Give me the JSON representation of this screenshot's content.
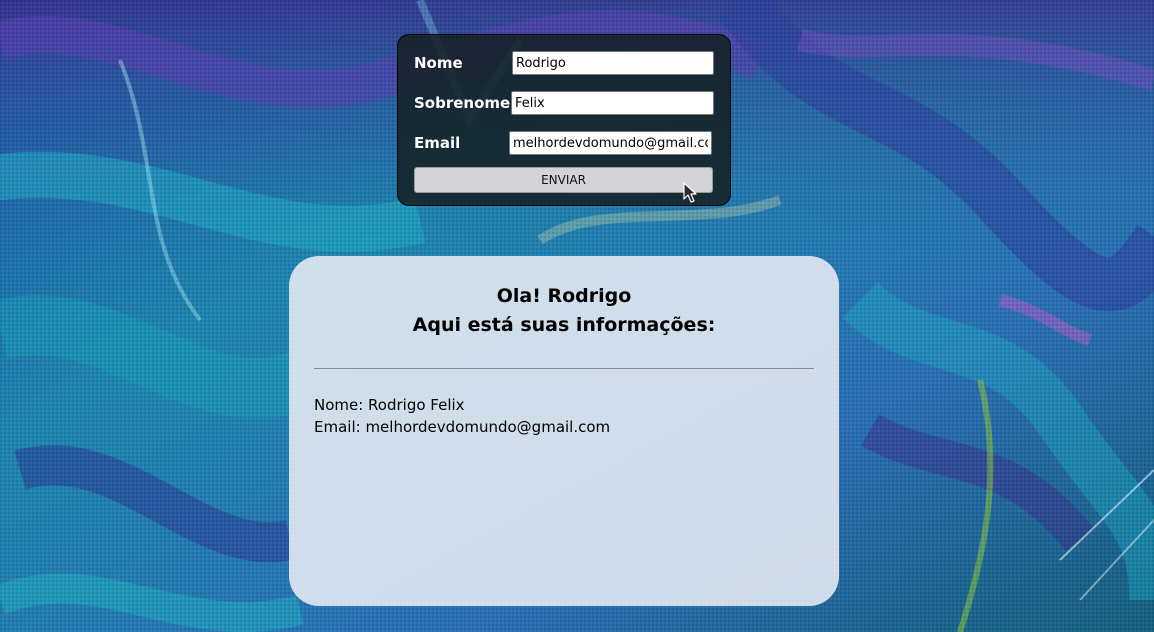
{
  "form": {
    "fields": [
      {
        "label": "Nome",
        "value": "Rodrigo",
        "placeholder": ""
      },
      {
        "label": "Sobrenome",
        "value": "Felix",
        "placeholder": ""
      },
      {
        "label": "Email",
        "value": "melhordevdomundo@gmail.com",
        "placeholder": ""
      }
    ],
    "submit_label": "ENVIAR"
  },
  "result": {
    "greeting": "Ola! Rodrigo",
    "subtitle": "Aqui está suas informações:",
    "name_line": "Nome: Rodrigo Felix",
    "email_line": "Email: melhordevdomundo@gmail.com"
  },
  "icons": {
    "cursor": "mouse-pointer-icon"
  },
  "colors": {
    "form_bg": "#142022",
    "card_bg": "#e8ecf4",
    "button_bg": "#d4d4d8",
    "background_teal": "#1e8fb0",
    "background_blue": "#243f9a"
  }
}
